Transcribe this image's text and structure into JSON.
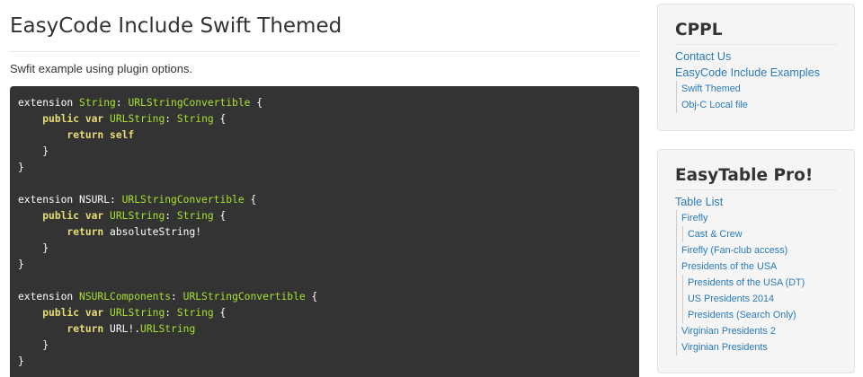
{
  "main": {
    "title": "EasyCode Include Swift Themed",
    "intro": "Swfit example using plugin options.",
    "code_lines": [
      [
        {
          "t": "extension ",
          "c": "pl"
        },
        {
          "t": "String",
          "c": "ty"
        },
        {
          "t": ": ",
          "c": "pl"
        },
        {
          "t": "URLStringConvertible",
          "c": "ty"
        },
        {
          "t": " {",
          "c": "pl"
        }
      ],
      [
        {
          "t": "    ",
          "c": "pl"
        },
        {
          "t": "public var",
          "c": "kw"
        },
        {
          "t": " ",
          "c": "pl"
        },
        {
          "t": "URLString",
          "c": "ty"
        },
        {
          "t": ": ",
          "c": "pl"
        },
        {
          "t": "String",
          "c": "ty"
        },
        {
          "t": " {",
          "c": "pl"
        }
      ],
      [
        {
          "t": "        ",
          "c": "pl"
        },
        {
          "t": "return self",
          "c": "kw"
        }
      ],
      [
        {
          "t": "    }",
          "c": "pl"
        }
      ],
      [
        {
          "t": "}",
          "c": "pl"
        }
      ],
      [
        {
          "t": "",
          "c": "pl"
        }
      ],
      [
        {
          "t": "extension NSURL: ",
          "c": "pl"
        },
        {
          "t": "URLStringConvertible",
          "c": "ty"
        },
        {
          "t": " {",
          "c": "pl"
        }
      ],
      [
        {
          "t": "    ",
          "c": "pl"
        },
        {
          "t": "public var",
          "c": "kw"
        },
        {
          "t": " ",
          "c": "pl"
        },
        {
          "t": "URLString",
          "c": "ty"
        },
        {
          "t": ": ",
          "c": "pl"
        },
        {
          "t": "String",
          "c": "ty"
        },
        {
          "t": " {",
          "c": "pl"
        }
      ],
      [
        {
          "t": "        ",
          "c": "pl"
        },
        {
          "t": "return",
          "c": "kw"
        },
        {
          "t": " absoluteString!",
          "c": "pl"
        }
      ],
      [
        {
          "t": "    }",
          "c": "pl"
        }
      ],
      [
        {
          "t": "}",
          "c": "pl"
        }
      ],
      [
        {
          "t": "",
          "c": "pl"
        }
      ],
      [
        {
          "t": "extension ",
          "c": "pl"
        },
        {
          "t": "NSURLComponents",
          "c": "ty"
        },
        {
          "t": ": ",
          "c": "pl"
        },
        {
          "t": "URLStringConvertible",
          "c": "ty"
        },
        {
          "t": " {",
          "c": "pl"
        }
      ],
      [
        {
          "t": "    ",
          "c": "pl"
        },
        {
          "t": "public var",
          "c": "kw"
        },
        {
          "t": " ",
          "c": "pl"
        },
        {
          "t": "URLString",
          "c": "ty"
        },
        {
          "t": ": ",
          "c": "pl"
        },
        {
          "t": "String",
          "c": "ty"
        },
        {
          "t": " {",
          "c": "pl"
        }
      ],
      [
        {
          "t": "        ",
          "c": "pl"
        },
        {
          "t": "return",
          "c": "kw"
        },
        {
          "t": " URL!.",
          "c": "pl"
        },
        {
          "t": "URLString",
          "c": "ty"
        }
      ],
      [
        {
          "t": "    }",
          "c": "pl"
        }
      ],
      [
        {
          "t": "}",
          "c": "pl"
        }
      ]
    ]
  },
  "sidebar": {
    "cppl": {
      "title": "CPPL",
      "contact": "Contact Us",
      "examples": "EasyCode Include Examples",
      "swift_themed": "Swift Themed",
      "objc_local": "Obj-C Local file"
    },
    "easytable": {
      "title": "EasyTable Pro!",
      "table_list": "Table List",
      "firefly": "Firefly",
      "cast_crew": "Cast & Crew",
      "firefly_fan": "Firefly (Fan-club access)",
      "presidents": "Presidents of the USA",
      "presidents_dt": "Presidents of the USA (DT)",
      "us_presidents_2014": "US Presidents 2014",
      "presidents_search": "Presidents (Search Only)",
      "virginian_2": "Virginian Presidents 2",
      "virginian": "Virginian Presidents"
    }
  },
  "colors": {
    "code_background": "#333333",
    "keyword": "#e6db74",
    "type": "#a6e22e",
    "link": "#2a7ab8"
  }
}
